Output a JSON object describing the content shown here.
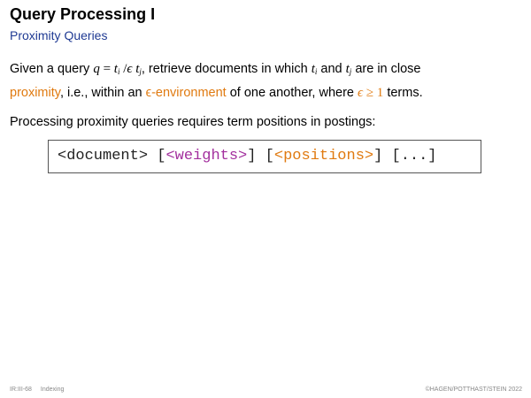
{
  "slide": {
    "title": "Query Processing I",
    "subtitle": "Proximity Queries"
  },
  "paragraph1": {
    "t1": "Given a query ",
    "q": "q",
    "eq": " = ",
    "ti": "t",
    "ti_sub": "i",
    "slash": " /",
    "eps": "ϵ",
    "tj": " t",
    "tj_sub": "j",
    "t2": ", retrieve documents in which ",
    "ti2": "t",
    "ti2_sub": "i",
    "t3": " and ",
    "tj2": "t",
    "tj2_sub": "j",
    "t4": " are in close",
    "proximity": "proximity",
    "t5": ", i.e., within an ",
    "eps_env": "ϵ-environment",
    "t6": " of one another, where ",
    "eps2": "ϵ",
    "geq": " ≥ 1",
    "t7": " terms."
  },
  "paragraph2": {
    "text": "Processing proximity queries requires term positions in postings:"
  },
  "code": {
    "document": "<document>",
    "sep1": " [",
    "weights": "<weights>",
    "sep2": "] [",
    "positions": "<positions>",
    "sep3": "] [...]"
  },
  "footer": {
    "page": "IR:III-68",
    "section": "Indexing",
    "copyright": "©HAGEN/POTTHAST/STEIN 2022"
  },
  "colors": {
    "subtitle": "#1f3a93",
    "highlight": "#e07a10",
    "weights": "#a3309e"
  }
}
